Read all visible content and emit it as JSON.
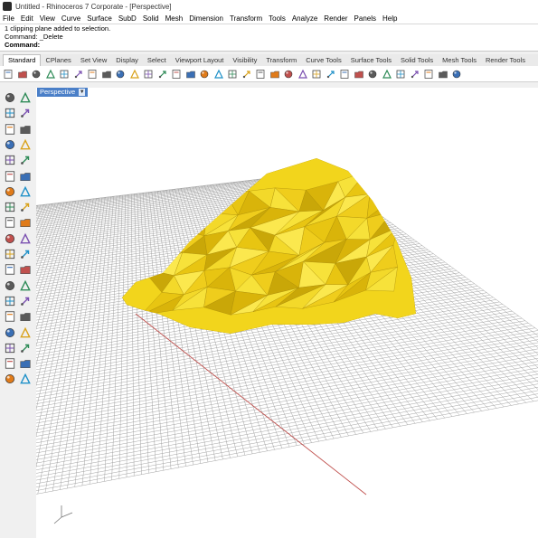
{
  "window": {
    "title": "Untitled - Rhinoceros 7 Corporate - [Perspective]"
  },
  "menu": {
    "items": [
      "File",
      "Edit",
      "View",
      "Curve",
      "Surface",
      "SubD",
      "Solid",
      "Mesh",
      "Dimension",
      "Transform",
      "Tools",
      "Analyze",
      "Render",
      "Panels",
      "Help"
    ]
  },
  "command": {
    "history": [
      "1 clipping plane added to selection.",
      "Command: _Delete"
    ],
    "prompt": "Command:"
  },
  "tabs": [
    "Standard",
    "CPlanes",
    "Set View",
    "Display",
    "Select",
    "Viewport Layout",
    "Visibility",
    "Transform",
    "Curve Tools",
    "Surface Tools",
    "Solid Tools",
    "Mesh Tools",
    "Render Tools"
  ],
  "active_tab": "Standard",
  "toolbar_icons": [
    "new-file-icon",
    "open-file-icon",
    "save-icon",
    "print-icon",
    "import-icon",
    "cut-icon",
    "copy-icon",
    "paste-icon",
    "undo-icon",
    "pan-icon",
    "rotate-view-icon",
    "zoom-icon",
    "zoom-window-icon",
    "zoom-extents-icon",
    "zoom-selected-icon",
    "undo-view-icon",
    "four-viewports-icon",
    "grid-icon",
    "cplane-icon",
    "layer-icon",
    "lightbulb-icon",
    "properties-icon",
    "osnap-icon",
    "box-icon",
    "wireframe-icon",
    "shaded-icon",
    "render-icon",
    "color-wheel-icon",
    "material-icon",
    "sphere-icon",
    "object-properties-icon",
    "environment-icon",
    "help-icon"
  ],
  "sidebar_icons": [
    "select-icon",
    "point-icon",
    "polyline-icon",
    "curve-icon",
    "circle-icon",
    "arc-icon",
    "rectangle-icon",
    "polygon-icon",
    "fillet-icon",
    "offset-icon",
    "surface-icon",
    "extrude-icon",
    "box-solid-icon",
    "sphere-solid-icon",
    "cylinder-icon",
    "mesh-icon",
    "boolean-union-icon",
    "explode-icon",
    "join-icon",
    "split-icon",
    "trim-icon",
    "move-icon",
    "copy-object-icon",
    "rotate-icon",
    "scale-icon",
    "mirror-icon",
    "array-icon",
    "text-icon",
    "dimension-icon",
    "hatch-icon",
    "group-icon",
    "ungroup-icon",
    "block-icon",
    "lock-icon",
    "hide-icon",
    "check-icon",
    "analyze-icon",
    "render-mesh-icon"
  ],
  "viewport": {
    "name": "Perspective",
    "dropdown_icon": "chevron-down-icon"
  },
  "colors": {
    "object_yellow": "#f2d51c",
    "grid_line": "#9a9a9a",
    "x_axis": "#c0504d",
    "viewport_tab": "#4a7fc8"
  }
}
